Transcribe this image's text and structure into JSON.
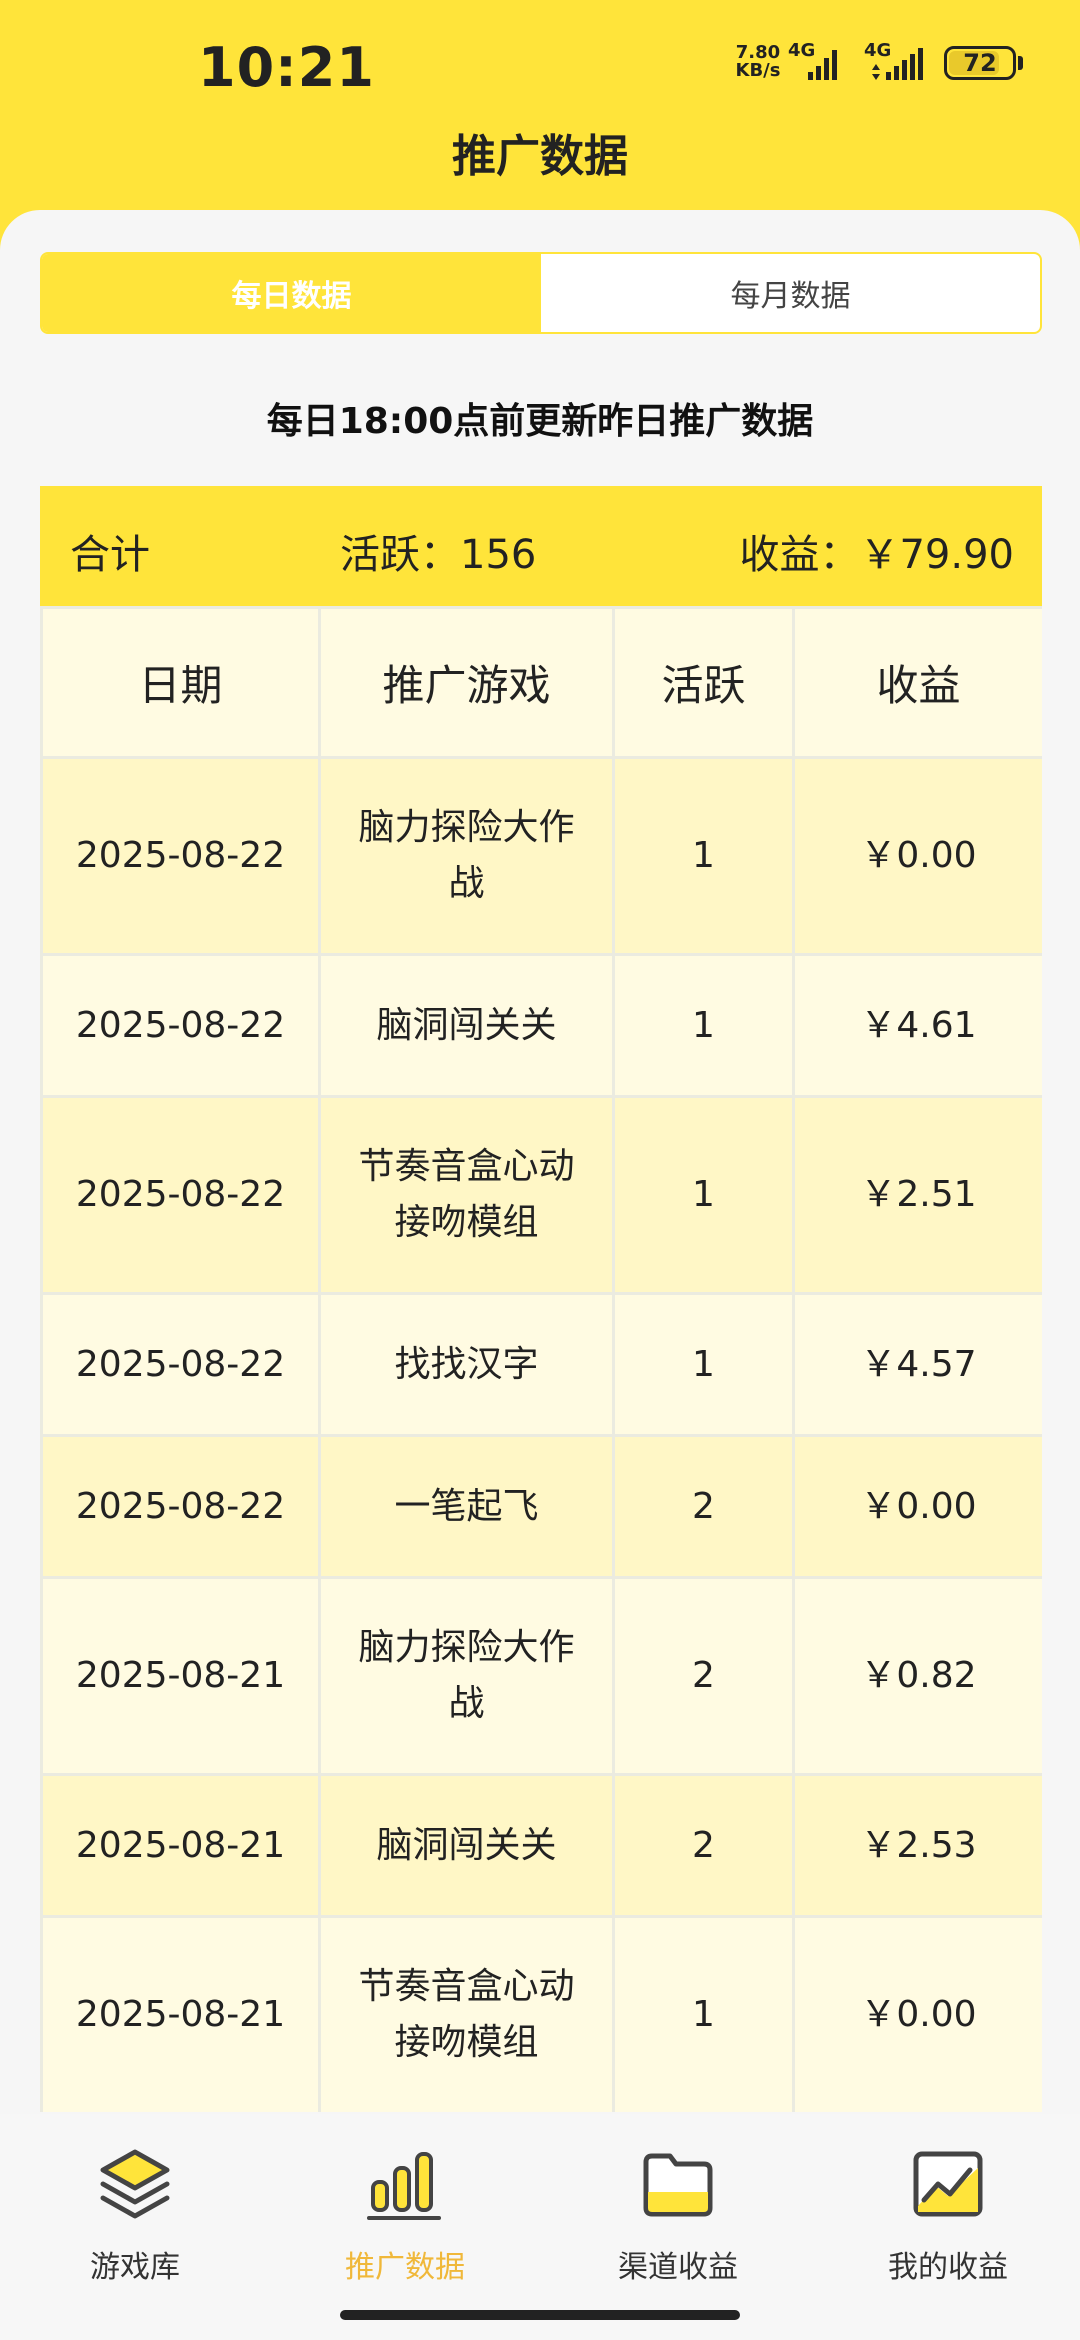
{
  "status_bar": {
    "time": "10:21",
    "net_speed_value": "7.80",
    "net_speed_unit": "KB/s",
    "signal1_label": "4G",
    "signal2_label": "4G",
    "battery": "72"
  },
  "header": {
    "title": "推广数据"
  },
  "segments": [
    {
      "label": "每日数据",
      "active": true
    },
    {
      "label": "每月数据",
      "active": false
    }
  ],
  "notice": "每日18:00点前更新昨日推广数据",
  "summary": {
    "label": "合计",
    "active": "活跃：156",
    "income": "收益：￥79.90"
  },
  "table": {
    "columns": [
      "日期",
      "推广游戏",
      "活跃",
      "收益"
    ],
    "rows": [
      {
        "date": "2025-08-22",
        "game": "脑力探险大作战",
        "active": "1",
        "income": "￥0.00"
      },
      {
        "date": "2025-08-22",
        "game": "脑洞闯关关",
        "active": "1",
        "income": "￥4.61"
      },
      {
        "date": "2025-08-22",
        "game": "节奏音盒心动接吻模组",
        "active": "1",
        "income": "￥2.51"
      },
      {
        "date": "2025-08-22",
        "game": "找找汉字",
        "active": "1",
        "income": "￥4.57"
      },
      {
        "date": "2025-08-22",
        "game": "一笔起飞",
        "active": "2",
        "income": "￥0.00"
      },
      {
        "date": "2025-08-21",
        "game": "脑力探险大作战",
        "active": "2",
        "income": "￥0.82"
      },
      {
        "date": "2025-08-21",
        "game": "脑洞闯关关",
        "active": "2",
        "income": "￥2.53"
      },
      {
        "date": "2025-08-21",
        "game": "节奏音盒心动接吻模组",
        "active": "1",
        "income": "￥0.00"
      }
    ]
  },
  "tabbar": {
    "items": [
      {
        "label": "游戏库",
        "icon": "layers-icon"
      },
      {
        "label": "推广数据",
        "icon": "bar-chart-icon",
        "active": true
      },
      {
        "label": "渠道收益",
        "icon": "folder-icon"
      },
      {
        "label": "我的收益",
        "icon": "trend-chart-icon"
      }
    ]
  },
  "colors": {
    "brand_yellow": "#ffe43a",
    "active_tab": "#f0b83a",
    "row_odd": "#fff7c6",
    "row_even": "#fffbe2"
  }
}
